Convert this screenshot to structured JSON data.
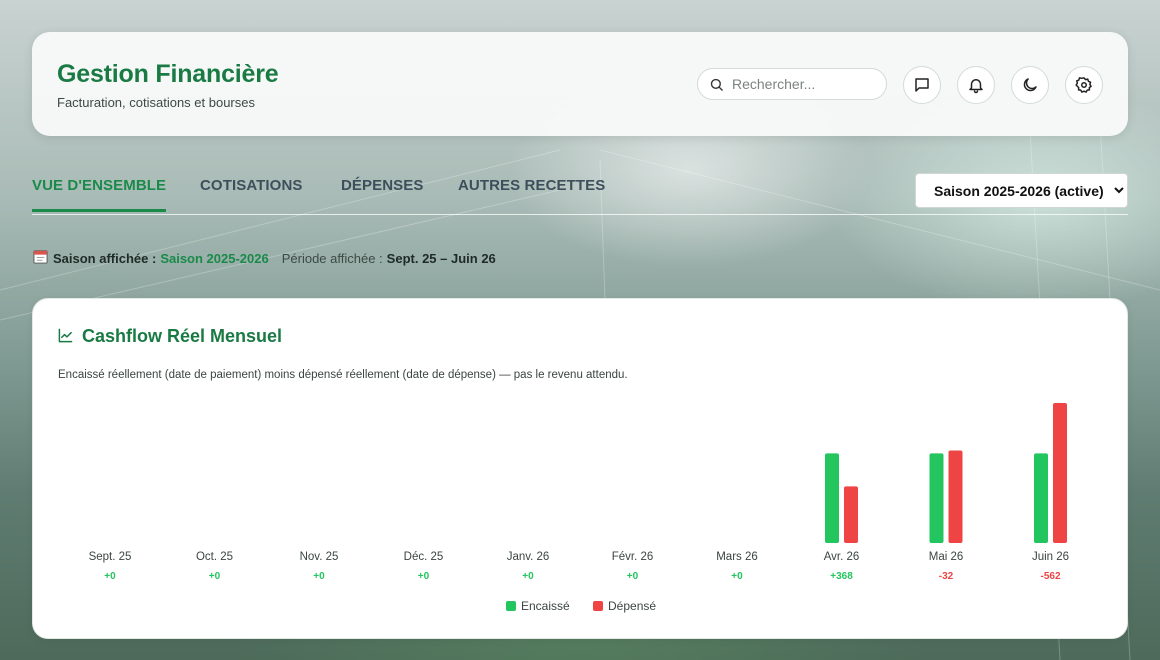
{
  "header": {
    "title": "Gestion Financière",
    "subtitle": "Facturation, cotisations et bourses",
    "search_placeholder": "Rechercher...",
    "icons": [
      "search-icon",
      "message-icon",
      "bell-icon",
      "moon-icon",
      "settings-icon"
    ]
  },
  "tabs": [
    {
      "label": "VUE D'ENSEMBLE",
      "active": true
    },
    {
      "label": "COTISATIONS",
      "active": false
    },
    {
      "label": "DÉPENSES",
      "active": false
    },
    {
      "label": "AUTRES RECETTES",
      "active": false
    }
  ],
  "season_select": {
    "value": "Saison 2025-2026 (active)"
  },
  "season_info": {
    "label": "Saison affichée :",
    "season": "Saison 2025-2026",
    "period_label": "Période affichée :",
    "period": "Sept. 25 – Juin 26"
  },
  "chart_card": {
    "title": "Cashflow Réel Mensuel",
    "description": "Encaissé réellement (date de paiement) moins dépensé réellement (date de dépense) — pas le revenu attendu."
  },
  "colors": {
    "brand_green": "#1a7a44",
    "encaisse": "#22c55e",
    "depense": "#ef4444"
  },
  "chart_data": {
    "type": "bar",
    "categories": [
      "Sept. 25",
      "Oct. 25",
      "Nov. 25",
      "Déc. 25",
      "Janv. 26",
      "Févr. 26",
      "Mars 26",
      "Avr. 26",
      "Mai 26",
      "Juin 26"
    ],
    "series": [
      {
        "name": "Encaissé",
        "values": [
          0,
          0,
          0,
          0,
          0,
          0,
          0,
          1000,
          1000,
          1000
        ]
      },
      {
        "name": "Dépensé",
        "values": [
          0,
          0,
          0,
          0,
          0,
          0,
          0,
          632,
          1032,
          1562
        ]
      }
    ],
    "net_labels": [
      "+0",
      "+0",
      "+0",
      "+0",
      "+0",
      "+0",
      "+0",
      "+368",
      "-32",
      "-562"
    ],
    "ylim": [
      0,
      1562
    ],
    "legend": "bottom-center",
    "grid": false
  }
}
